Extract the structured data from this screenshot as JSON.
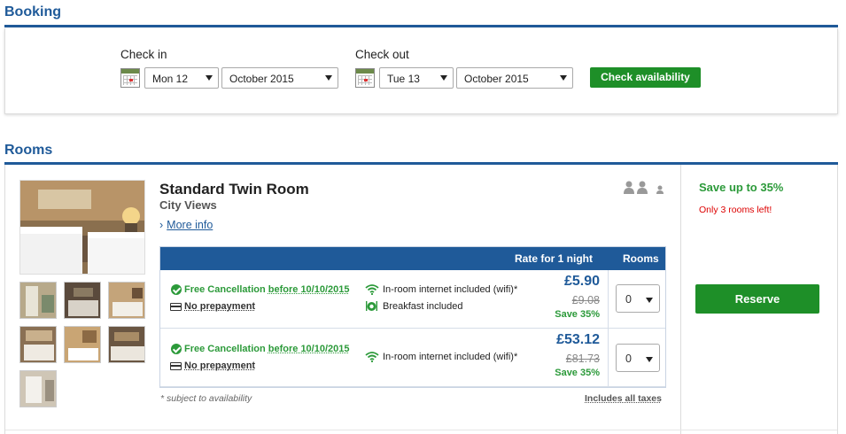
{
  "booking": {
    "title": "Booking",
    "check_in": {
      "label": "Check in",
      "day": "Mon 12",
      "month": "October 2015"
    },
    "check_out": {
      "label": "Check out",
      "day": "Tue 13",
      "month": "October 2015"
    },
    "check_button": "Check availability"
  },
  "rooms": {
    "title": "Rooms",
    "room": {
      "name": "Standard Twin Room",
      "view": "City Views",
      "more_info": "More info",
      "table_header": {
        "rate": "Rate for 1 night",
        "rooms": "Rooms"
      },
      "rates": [
        {
          "cancellation_prefix": "Free Cancellation",
          "cancellation_date": "before 10/10/2015",
          "prepayment": "No prepayment",
          "features": [
            "In-room internet included (wifi)*",
            "Breakfast included"
          ],
          "price": "£5.90",
          "old_price": "£9.08",
          "save": "Save 35%",
          "qty": "0"
        },
        {
          "cancellation_prefix": "Free Cancellation",
          "cancellation_date": "before 10/10/2015",
          "prepayment": "No prepayment",
          "features": [
            "In-room internet included (wifi)*"
          ],
          "price": "£53.12",
          "old_price": "£81.73",
          "save": "Save 35%",
          "qty": "0"
        }
      ],
      "footnote": "* subject to availability",
      "taxes": "Includes all taxes"
    },
    "promo": {
      "save": "Save up to 35%",
      "availability": "Only 3 rooms left!"
    },
    "reserve_button": "Reserve"
  },
  "colors": {
    "brand_blue": "#1f5a99",
    "accent_green": "#1e8f28",
    "alert_red": "#dd0000"
  }
}
